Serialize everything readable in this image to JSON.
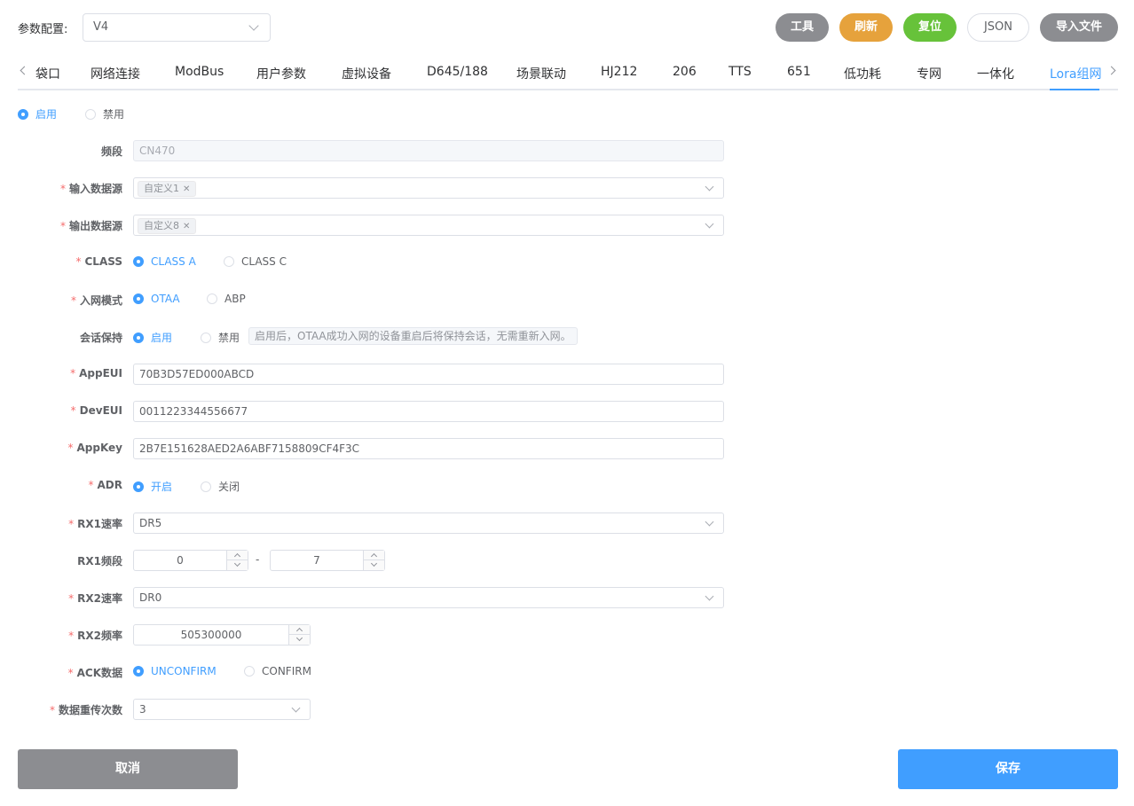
{
  "header": {
    "config_label": "参数配置:",
    "config_value": "V4",
    "buttons": {
      "tools": "工具",
      "refresh": "刷新",
      "reset": "复位",
      "json": "JSON",
      "import": "导入文件"
    }
  },
  "tabs": [
    "袋口",
    "网络连接",
    "ModBus",
    "用户参数",
    "虚拟设备",
    "D645/188",
    "场景联动",
    "HJ212",
    "206",
    "TTS",
    "651",
    "低功耗",
    "专网",
    "一体化",
    "Lora组网"
  ],
  "active_tab": "Lora组网",
  "enable": {
    "on": "启用",
    "off": "禁用",
    "selected": "启用"
  },
  "form": {
    "band": {
      "label": "频段",
      "value": "CN470"
    },
    "input_source": {
      "label": "输入数据源",
      "tag": "自定义1"
    },
    "output_source": {
      "label": "输出数据源",
      "tag": "自定义8"
    },
    "class": {
      "label": "CLASS",
      "a": "CLASS A",
      "c": "CLASS C",
      "selected": "CLASS A"
    },
    "join_mode": {
      "label": "入网模式",
      "otaa": "OTAA",
      "abp": "ABP",
      "selected": "OTAA"
    },
    "session": {
      "label": "会话保持",
      "on": "启用",
      "off": "禁用",
      "selected": "启用",
      "hint": "启用后，OTAA成功入网的设备重启后将保持会话，无需重新入网。"
    },
    "appeui": {
      "label": "AppEUI",
      "value": "70B3D57ED000ABCD"
    },
    "deveui": {
      "label": "DevEUI",
      "value": "0011223344556677"
    },
    "appkey": {
      "label": "AppKey",
      "value": "2B7E151628AED2A6ABF7158809CF4F3C"
    },
    "adr": {
      "label": "ADR",
      "on": "开启",
      "off": "关闭",
      "selected": "开启"
    },
    "rx1_rate": {
      "label": "RX1速率",
      "value": "DR5"
    },
    "rx1_band": {
      "label": "RX1频段",
      "from": "0",
      "sep": "-",
      "to": "7"
    },
    "rx2_rate": {
      "label": "RX2速率",
      "value": "DR0"
    },
    "rx2_freq": {
      "label": "RX2频率",
      "value": "505300000"
    },
    "ack": {
      "label": "ACK数据",
      "unconfirm": "UNCONFIRM",
      "confirm": "CONFIRM",
      "selected": "UNCONFIRM"
    },
    "retries": {
      "label": "数据重传次数",
      "value": "3"
    }
  },
  "footer": {
    "cancel": "取消",
    "save": "保存"
  },
  "colors": {
    "primary": "#409eff",
    "warning": "#e6a23c",
    "success": "#67c23a",
    "gray": "#8c8d91",
    "required": "#f56c6c"
  }
}
